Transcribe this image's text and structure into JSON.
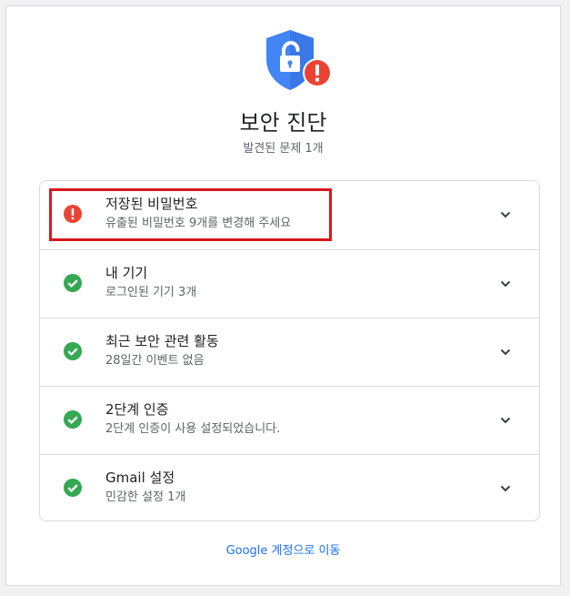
{
  "header": {
    "title": "보안 진단",
    "subtitle": "발견된 문제 1개",
    "icon": "shield-lock-alert-icon"
  },
  "colors": {
    "shield": "#4285f4",
    "alert": "#ea4335",
    "ok": "#34a853",
    "link": "#1a73e8",
    "highlight_box": "#d8181f"
  },
  "items": [
    {
      "title": "저장된 비밀번호",
      "description": "유출된 비밀번호 9개를 변경해 주세요",
      "status": "alert"
    },
    {
      "title": "내 기기",
      "description": "로그인된 기기 3개",
      "status": "ok"
    },
    {
      "title": "최근 보안 관련 활동",
      "description": "28일간 이벤트 없음",
      "status": "ok"
    },
    {
      "title": "2단계 인증",
      "description": "2단계 인증이 사용 설정되었습니다.",
      "status": "ok"
    },
    {
      "title": "Gmail 설정",
      "description": "민감한 설정 1개",
      "status": "ok"
    }
  ],
  "footer": {
    "link_label": "Google 계정으로 이동"
  }
}
